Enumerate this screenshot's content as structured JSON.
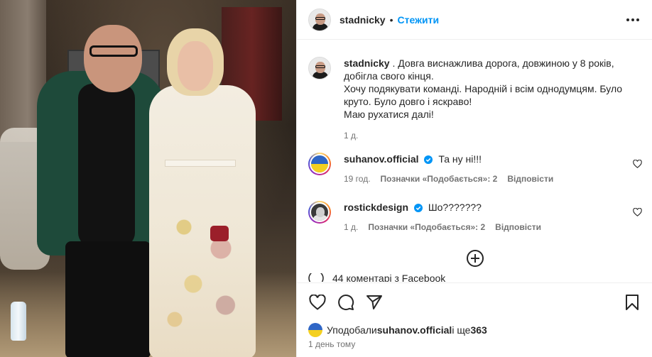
{
  "post": {
    "author": "stadnicky",
    "follow_label": "Стежити",
    "separator": "•",
    "more_icon": "more-horizontal-icon"
  },
  "caption": {
    "username": "stadnicky",
    "text": " . Довга виснажлива дорога, довжиною у 8 років, добігла свого кінця.",
    "lines": [
      "Хочу подякувати команді. Народній і всім однодумцям. Було круто. Було довго і яскраво!",
      "Маю рухатися далі!"
    ],
    "time": "1 д."
  },
  "comments": [
    {
      "username": "suhanov.official",
      "verified": true,
      "text": "Та ну ні!!!",
      "time": "19 год.",
      "likes_label": "Позначки «Подобається»: 2",
      "reply_label": "Відповісти"
    },
    {
      "username": "rostickdesign",
      "verified": true,
      "text": "Шо???????",
      "time": "1 д.",
      "likes_label": "Позначки «Подобається»: 2",
      "reply_label": "Відповісти"
    }
  ],
  "facebook_row": {
    "text": "44 коментарі з Facebook"
  },
  "likes": {
    "prefix": "Уподобали ",
    "user": "suhanov.official",
    "middle": " і ще ",
    "count": "363"
  },
  "timestamp": "1 день тому",
  "colors": {
    "accent": "#0095f6",
    "text": "#262626",
    "muted": "#737373",
    "verified": "#0095f6"
  }
}
